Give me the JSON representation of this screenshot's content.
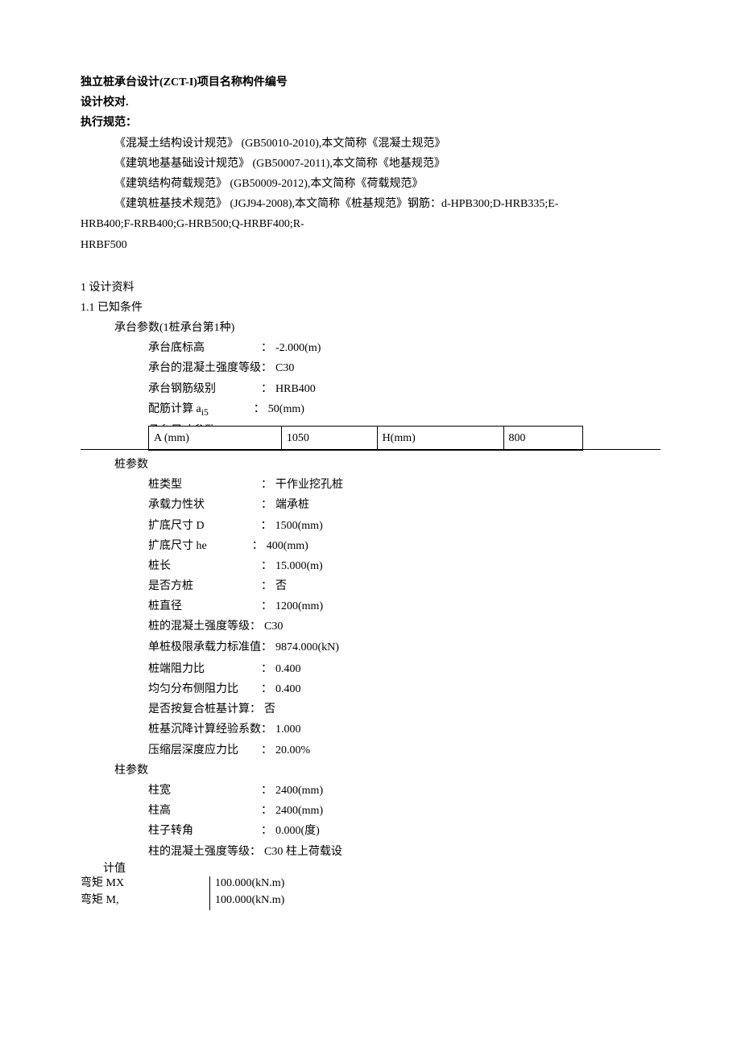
{
  "header": {
    "title_line": "独立桩承台设计(ZCT-I)项目名称构件编号",
    "check_line": "设计校对.",
    "spec_heading": "执行规范："
  },
  "specs": [
    "《混凝土结构设计规范》 (GB50010-2010),本文简称《混凝土规范》",
    "《建筑地基基础设计规范》 (GB50007-2011),本文简称《地基规范》",
    "《建筑结构荷载规范》 (GB50009-2012),本文简称《荷载规范》"
  ],
  "rebar_spec_prefix": "《建筑桩基技术规范》 (JGJ94-2008),本文简称《桩基规范》钢筋：d-HPB300;D-HRB335;E-",
  "rebar_spec_line2": "HRB400;F-RRB400;G-HRB500;Q-HRBF400;R-",
  "rebar_spec_line3": "HRBF500",
  "sec1": {
    "title": "1 设计资料",
    "sub": "1.1 已知条件",
    "cap_params_title": "承台参数(1桩承台第1种)",
    "rows": [
      {
        "label": "承台底标高",
        "value": "-2.000(m)"
      },
      {
        "label": "承台的混凝土强度等级",
        "value": "C30",
        "tight": true
      },
      {
        "label": "承台钢筋级别",
        "value": "HRB400"
      },
      {
        "label": "配筋计算 a",
        "sub": "i5",
        "value": "50(mm)"
      }
    ],
    "dim_note": "承台尺寸参数",
    "dim_table": {
      "c0": "A (mm)",
      "c1": "1050",
      "c2": "H(mm)",
      "c3": "800"
    },
    "pile_title": "桩参数",
    "pile_rows": [
      {
        "label": "桩类型",
        "value": "干作业挖孔桩"
      },
      {
        "label": "承载力性状",
        "value": "端承桩"
      },
      {
        "label": "扩底尺寸 D",
        "value": "1500(mm)"
      },
      {
        "label": "扩底尺寸 he",
        "value": "400(mm)"
      },
      {
        "label": "桩长",
        "value": "15.000(m)"
      },
      {
        "label": "是否方桩",
        "value": "否"
      },
      {
        "label": "桩直径",
        "value": "1200(mm)"
      },
      {
        "label": "桩的混凝土强度等级",
        "value": "C30",
        "tight": true
      },
      {
        "label": "单桩极限承载力标准值",
        "value": "9874.000(kN)",
        "tight": true
      },
      {
        "label": "桩端阻力比",
        "value": "0.400"
      },
      {
        "label": "均匀分布侧阻力比",
        "value": "0.400"
      },
      {
        "label": "是否按复合桩基计算",
        "value": "否",
        "tight": true
      },
      {
        "label": "桩基沉降计算经验系数",
        "value": "1.000",
        "tight": true
      },
      {
        "label": "压缩层深度应力比",
        "value": "20.00%"
      }
    ],
    "col_title": "柱参数",
    "col_rows": [
      {
        "label": "柱宽",
        "value": "2400(mm)"
      },
      {
        "label": "柱高",
        "value": "2400(mm)"
      },
      {
        "label": "柱子转角",
        "value": "0.000(度)"
      },
      {
        "label": "柱的混凝土强度等级",
        "value": "C30 柱上荷载设",
        "tight": true
      }
    ],
    "design_note": "计值",
    "design_rows": [
      {
        "label": "弯矩 MX",
        "value": "100.000(kN.m)"
      },
      {
        "label": "弯矩 M,",
        "value": "100.000(kN.m)"
      }
    ]
  }
}
